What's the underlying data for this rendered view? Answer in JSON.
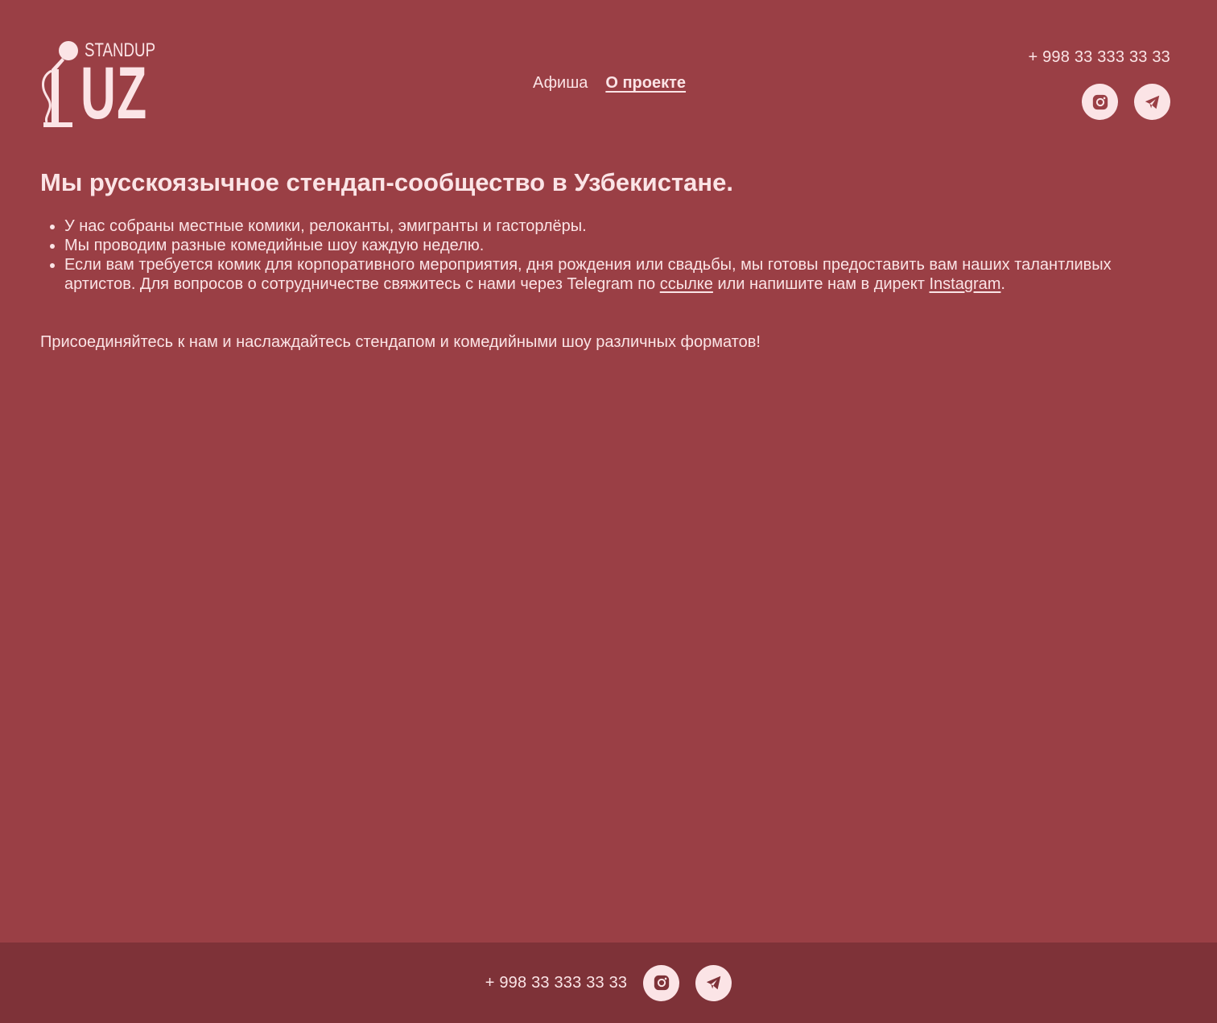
{
  "header": {
    "logo": {
      "top_text": "STANDUP",
      "main_text": "UZ"
    },
    "nav": [
      {
        "label": "Афиша"
      },
      {
        "label": "О проекте"
      }
    ],
    "phone": "+ 998 33 333 33 33",
    "social": [
      {
        "icon": "instagram-icon"
      },
      {
        "icon": "telegram-icon"
      }
    ]
  },
  "main": {
    "title": "Мы русскоязычное стендап-сообщество в Узбекистане.",
    "features": [
      "У нас собраны местные комики, релоканты, эмигранты и гасторлёры.",
      "Мы проводим разные комедийные шоу каждую неделю."
    ],
    "feature3": {
      "text_before": "Если вам требуется комик для корпоративного мероприятия, дня рождения или свадьбы, мы готовы предоставить вам наших талантливых артистов. Для вопросов о сотрудничестве свяжитесь с нами через Telegram по ",
      "link1": "ссылке",
      "text_middle": " или напишите нам в директ ",
      "link2": "Instagram",
      "text_after": "."
    },
    "join_text": "Присоединяйтесь к нам и наслаждайтесь стендапом и комедийными шоу различных форматов!"
  },
  "footer": {
    "phone": "+ 998 33 333 33 33"
  },
  "colors": {
    "background": "#9a3f45",
    "footer_background": "#7e3238",
    "text": "#fbe4e6",
    "icon": "#9a3f45"
  }
}
